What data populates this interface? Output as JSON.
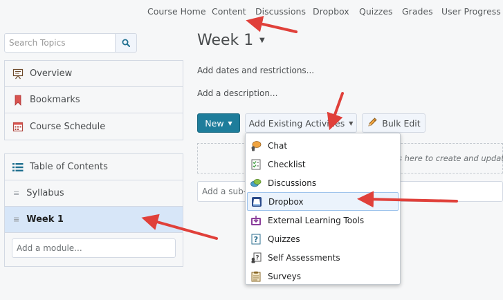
{
  "topnav": {
    "items": [
      "Course Home",
      "Content",
      "Discussions",
      "Dropbox",
      "Quizzes",
      "Grades",
      "User Progress"
    ]
  },
  "sidebar": {
    "search_placeholder": "Search Topics",
    "top_panel": [
      {
        "label": "Overview",
        "icon": "overview-icon"
      },
      {
        "label": "Bookmarks",
        "icon": "bookmark-icon"
      },
      {
        "label": "Course Schedule",
        "icon": "calendar-icon"
      }
    ],
    "toc_label": "Table of Contents",
    "modules": [
      "Syllabus",
      "Week 1"
    ],
    "selected_module": "Week 1",
    "add_module_placeholder": "Add a module..."
  },
  "main": {
    "title": "Week 1",
    "add_dates": "Add dates and restrictions...",
    "add_description": "Add a description...",
    "new_button": "New",
    "add_existing_button": "Add Existing Activities",
    "bulk_edit_button": "Bulk Edit",
    "drop_hint": "s here to create and update",
    "sub_module_placeholder": "Add a sub-m"
  },
  "dropdown": {
    "items": [
      {
        "label": "Chat",
        "icon": "chat-icon"
      },
      {
        "label": "Checklist",
        "icon": "checklist-icon"
      },
      {
        "label": "Discussions",
        "icon": "discussions-icon"
      },
      {
        "label": "Dropbox",
        "icon": "dropbox-icon"
      },
      {
        "label": "External Learning Tools",
        "icon": "external-tools-icon"
      },
      {
        "label": "Quizzes",
        "icon": "quiz-icon"
      },
      {
        "label": "Self Assessments",
        "icon": "self-assessment-icon"
      },
      {
        "label": "Surveys",
        "icon": "survey-icon"
      }
    ],
    "highlighted": "Dropbox"
  },
  "colors": {
    "accent": "#1e7d9b",
    "selected_bg": "#d7e6f8",
    "annotation_arrow": "#e0403a"
  }
}
